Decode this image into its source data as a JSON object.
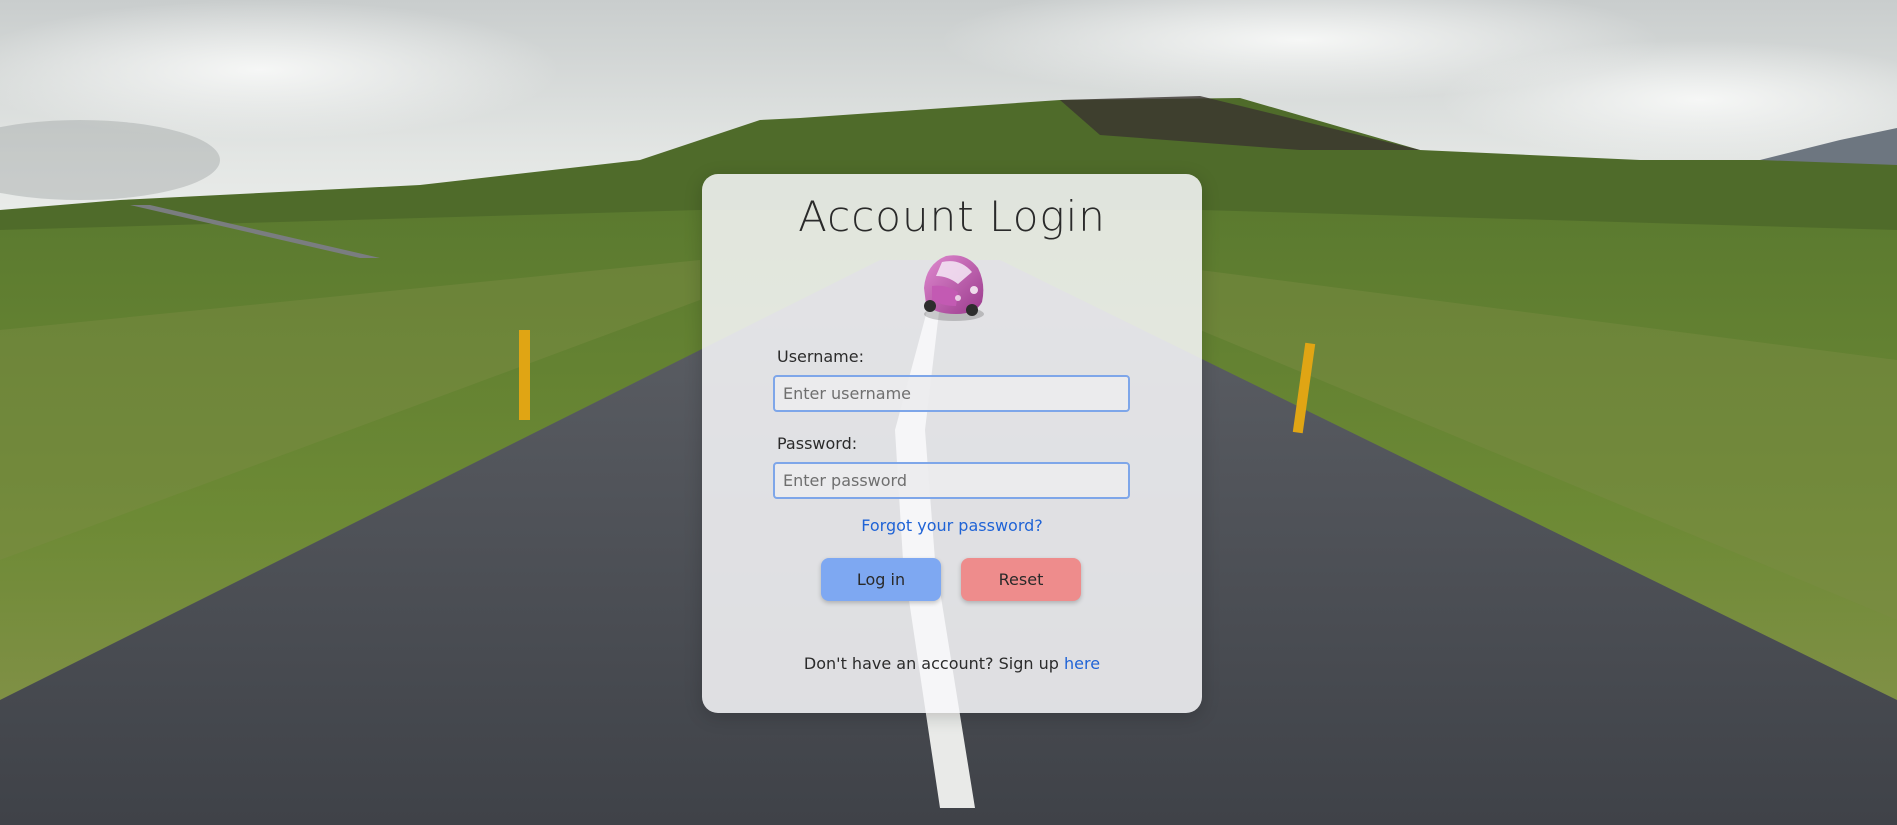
{
  "page": {
    "title": "Account Login"
  },
  "form": {
    "username_label": "Username:",
    "username_placeholder": "Enter username",
    "username_value": "",
    "password_label": "Password:",
    "password_placeholder": "Enter password",
    "password_value": "",
    "forgot_link": "Forgot your password?",
    "login_button": "Log in",
    "reset_button": "Reset"
  },
  "signup": {
    "prompt": "Don't have an account? Sign up",
    "link": "here"
  },
  "icons": {
    "logo": "pink-car-icon"
  },
  "colors": {
    "link": "#1f63d6",
    "login_button": "#7ea8f2",
    "reset_button": "#ee8c8c",
    "input_border": "#7ea6e9"
  }
}
